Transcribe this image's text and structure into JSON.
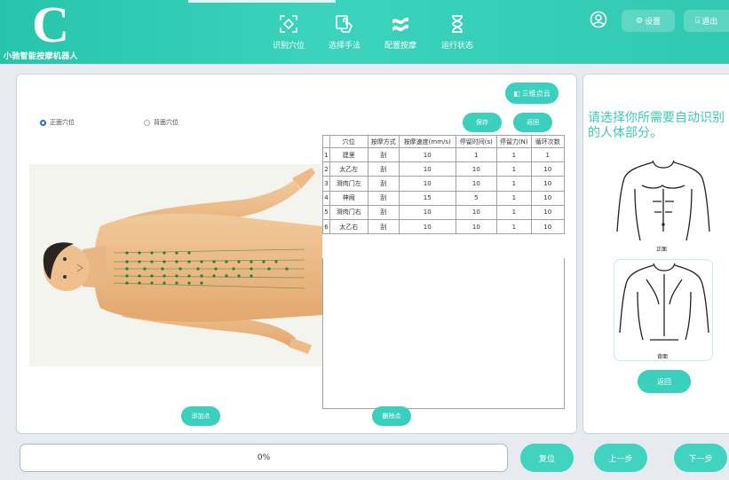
{
  "app": {
    "logo_letter": "C",
    "title": "小驰智能按摩机器人"
  },
  "nav": [
    {
      "label": "识别穴位",
      "icon": "target-scan-icon"
    },
    {
      "label": "选择手法",
      "icon": "hand-pointer-icon"
    },
    {
      "label": "配置按摩",
      "icon": "waves-icon"
    },
    {
      "label": "运行状态",
      "icon": "hourglass-icon"
    }
  ],
  "header_buttons": {
    "settings": "设置",
    "logout": "退出"
  },
  "toolbar": {
    "cloud_button": "三维点云",
    "save": "保存",
    "back": "返回"
  },
  "view_tabs": {
    "front": "正面穴位",
    "back": "背面穴位",
    "selected": "front"
  },
  "table": {
    "headers": [
      "",
      "穴位",
      "按摩方式",
      "按摩速度(mm/s)",
      "停留时间(s)",
      "停留力(N)",
      "循环次数"
    ],
    "rows": [
      [
        "1",
        "建里",
        "刮",
        "10",
        "1",
        "1",
        "1"
      ],
      [
        "2",
        "太乙左",
        "刮",
        "10",
        "10",
        "1",
        "10"
      ],
      [
        "3",
        "滑肉门左",
        "刮",
        "10",
        "10",
        "1",
        "10"
      ],
      [
        "4",
        "神阙",
        "刮",
        "15",
        "5",
        "1",
        "10"
      ],
      [
        "5",
        "滑肉门右",
        "刮",
        "10",
        "10",
        "1",
        "10"
      ],
      [
        "6",
        "太乙右",
        "刮",
        "10",
        "10",
        "1",
        "10"
      ]
    ]
  },
  "actions": {
    "add_point": "添加点",
    "delete_point": "删除点"
  },
  "side": {
    "prompt": "请选择你所需要自动识别的人体部分。",
    "front_label": "正面",
    "back_label": "背面",
    "return_button": "返回"
  },
  "footer": {
    "progress": "0%",
    "progress_value": 0,
    "reset": "复位",
    "prev": "上一步",
    "next": "下一步"
  },
  "colors": {
    "accent": "#3ad0bd",
    "header_start": "#27c4ac",
    "header_end": "#31c9b1",
    "prompt": "#3fc8b4"
  }
}
